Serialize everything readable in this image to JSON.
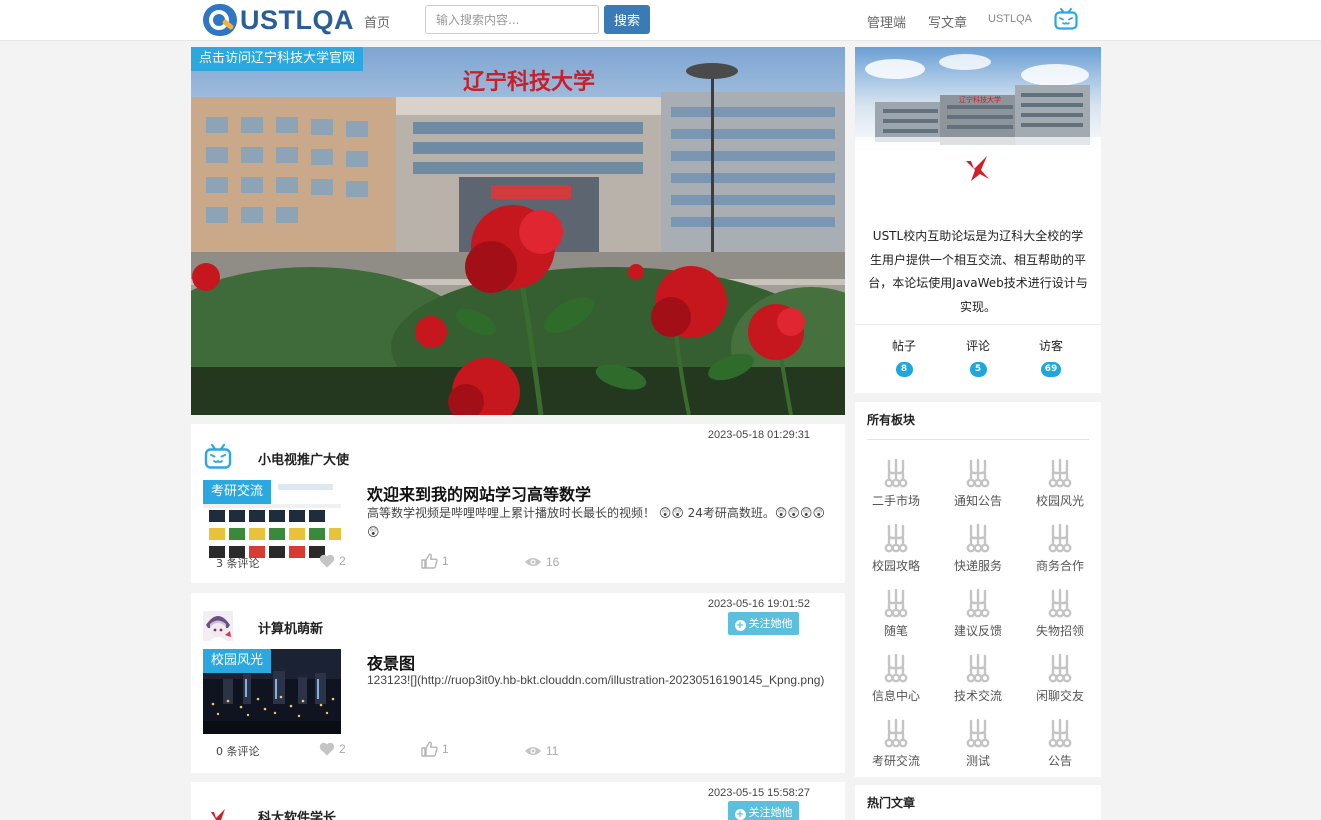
{
  "nav": {
    "logo_text": "USTLQA",
    "home": "首页",
    "search_placeholder": "输入搜索内容...",
    "search_button": "搜索",
    "admin": "管理端",
    "write": "写文章",
    "user": "USTLQA"
  },
  "banner": {
    "label": "点击访问辽宁科技大学官网",
    "sign": "辽宁科技大学",
    "slide_count": 3,
    "active_slide": 3
  },
  "posts": [
    {
      "time": "2023-05-18 01:29:31",
      "author": "小电视推广大使",
      "avatar": "tv-icon",
      "follow": "",
      "tag": "考研交流",
      "title": "欢迎来到我的网站学习高等数学",
      "excerpt": "高等数学视频是哔哩哔哩上累计播放时长最长的视频！ 😲😲 24考研高数班。😲😲😲😲😲",
      "comments": "3 条评论",
      "likes": "2",
      "thumbs": "1",
      "views": "16"
    },
    {
      "time": "2023-05-16 19:01:52",
      "author": "计算机萌新",
      "avatar": "girl-avatar",
      "follow": "关注她他",
      "tag": "校园风光",
      "title": "夜景图",
      "excerpt": "123123![](http://ruop3it0y.hb-bkt.clouddn.com/illustration-20230516190145_Kpng.png)",
      "comments": "0 条评论",
      "likes": "2",
      "thumbs": "1",
      "views": "11"
    },
    {
      "time": "2023-05-15 15:58:27",
      "author": "科大软件学长",
      "avatar": "ustl-logo",
      "follow": "关注她他"
    }
  ],
  "sidebar": {
    "photo_sign": "辽宁科技大学",
    "description": "USTL校内互助论坛是为辽科大全校的学生用户提供一个相互交流、相互帮助的平台，本论坛使用JavaWeb技术进行设计与实现。",
    "stats": [
      {
        "label": "帖子",
        "value": "8"
      },
      {
        "label": "评论",
        "value": "5"
      },
      {
        "label": "访客",
        "value": "69"
      }
    ],
    "boards_title": "所有板块",
    "boards": [
      "二手市场",
      "通知公告",
      "校园风光",
      "校园攻略",
      "快递服务",
      "商务合作",
      "随笔",
      "建议反馈",
      "失物招领",
      "信息中心",
      "技术交流",
      "闲聊交友",
      "考研交流",
      "测试",
      "公告"
    ],
    "hot_title": "热门文章"
  },
  "colors": {
    "accent": "#2ba8df",
    "button": "#3a7ab7",
    "follow": "#5bc0de",
    "badge": "#1fa6dc",
    "logo_red": "#d11f2a"
  }
}
